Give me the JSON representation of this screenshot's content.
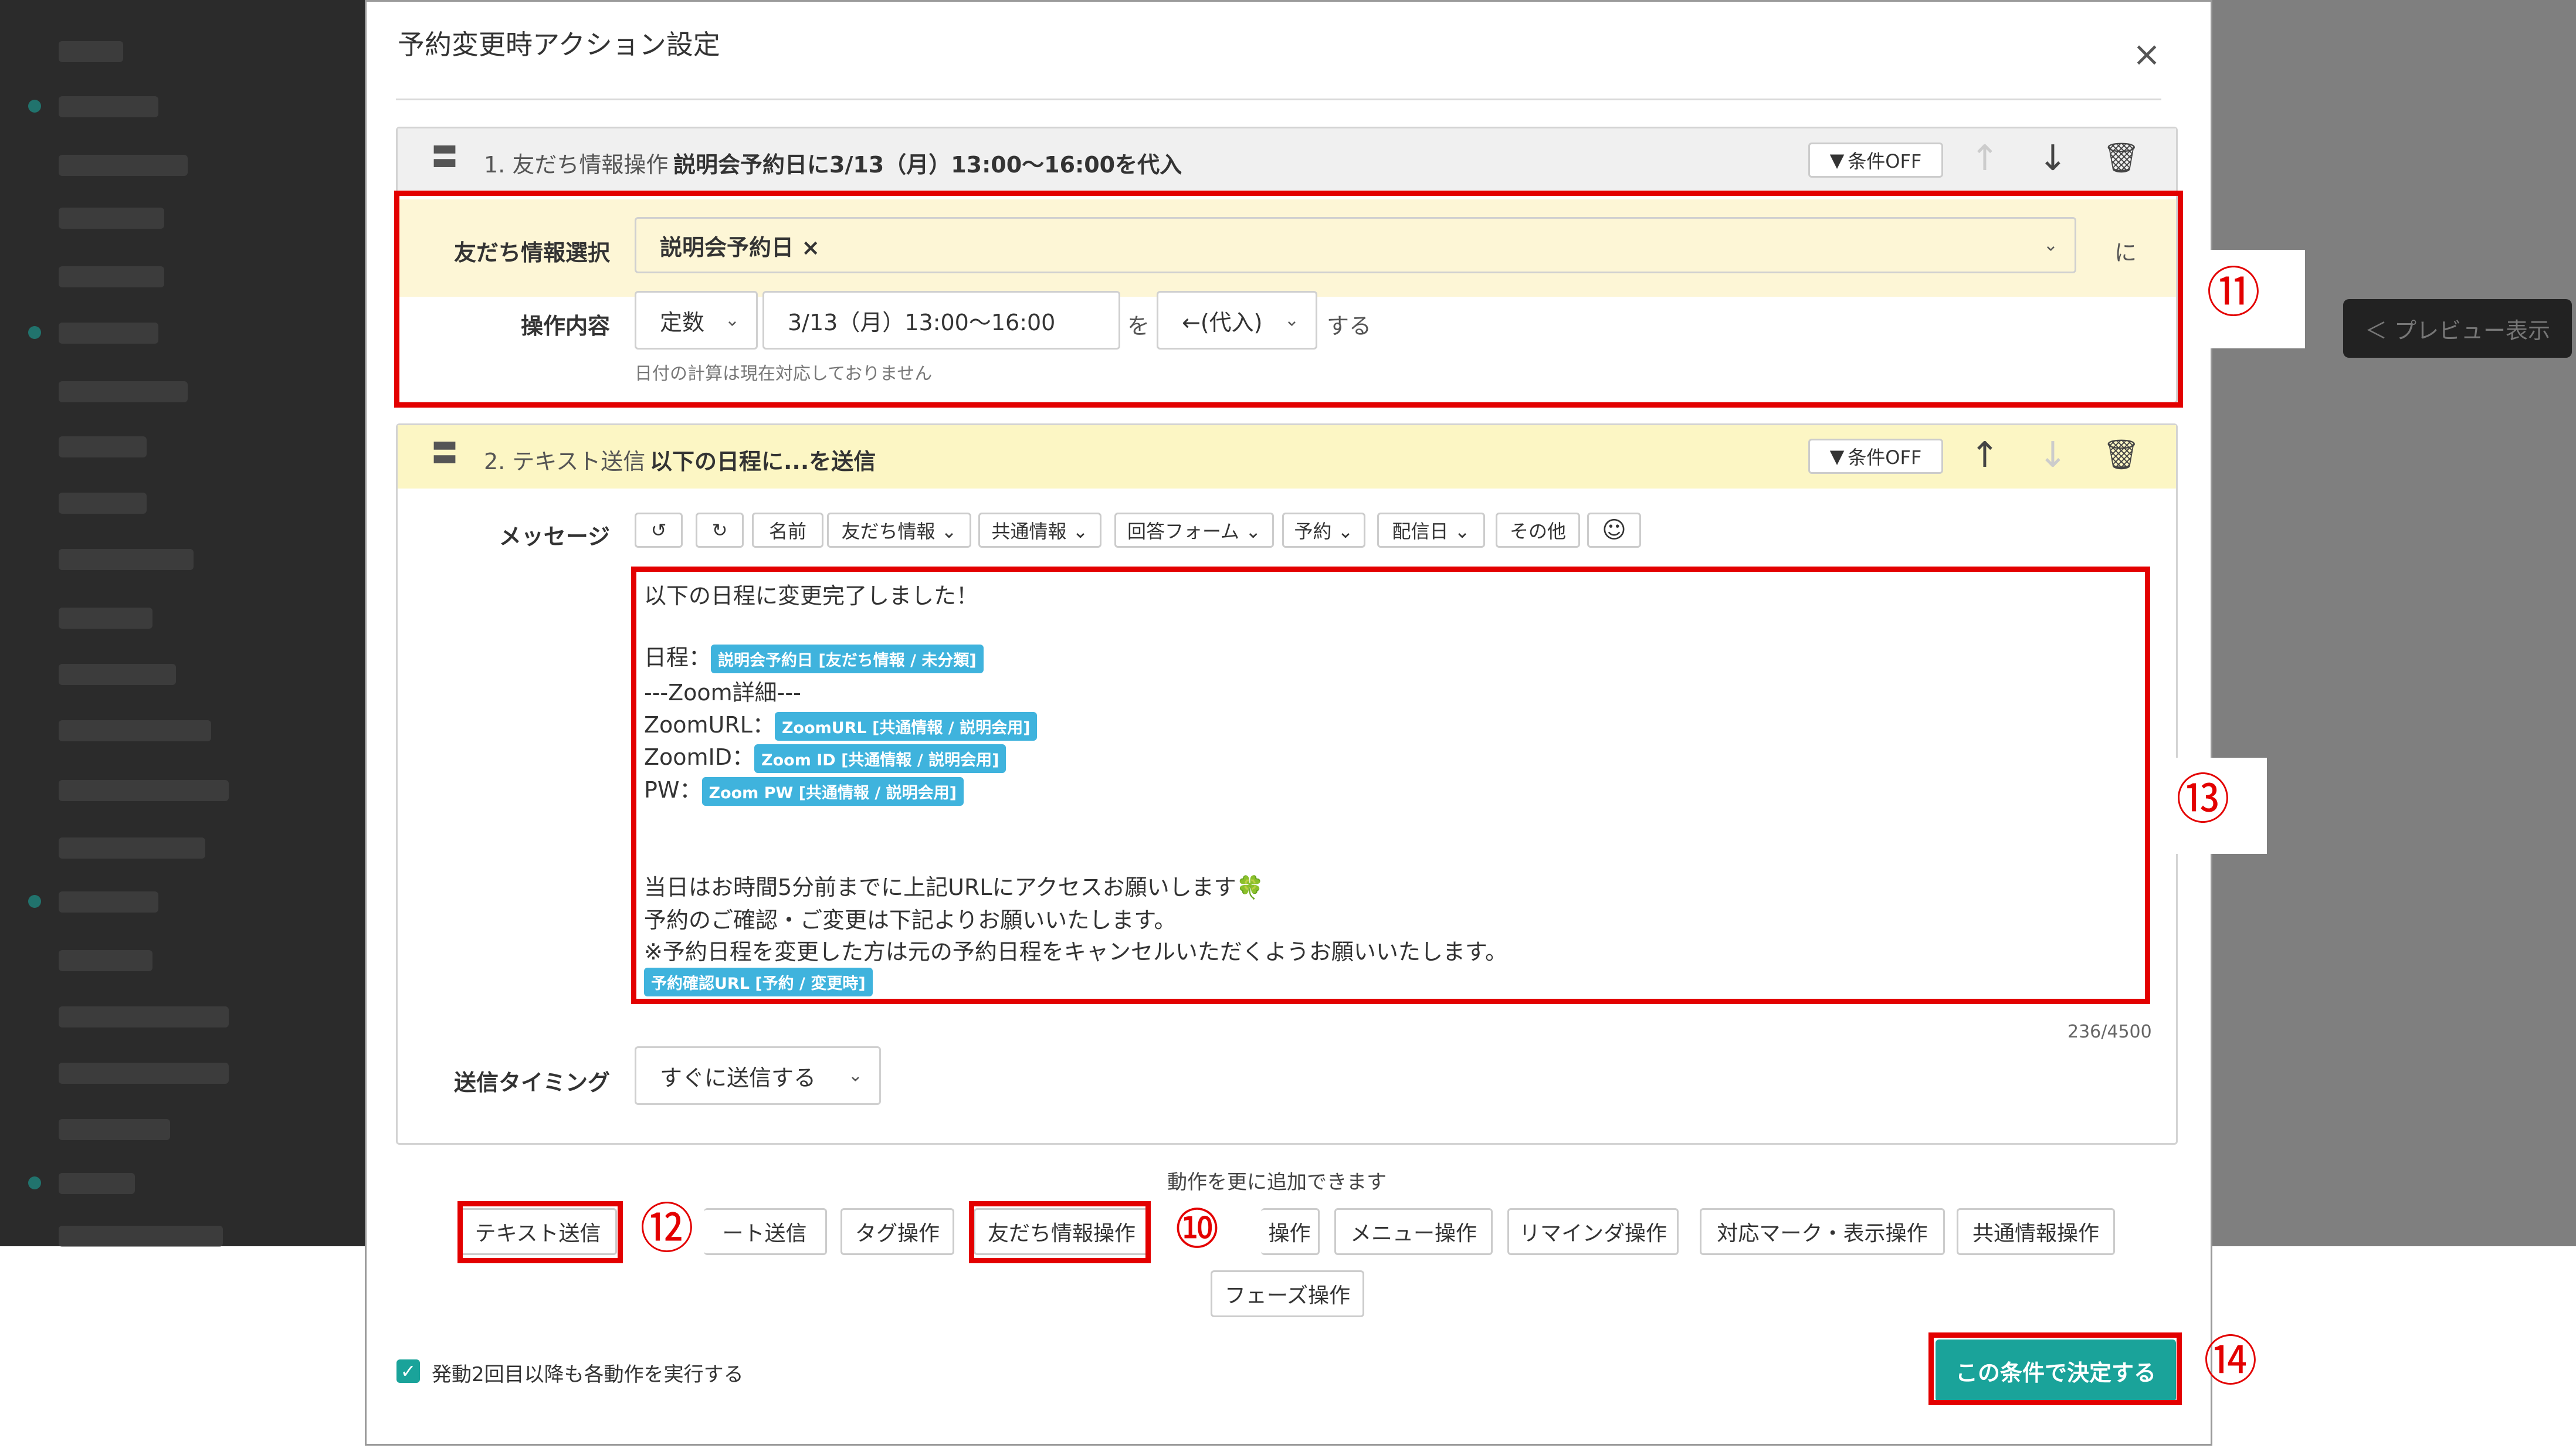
{
  "modal": {
    "title": "予約変更時アクション設定",
    "close": "×"
  },
  "action1": {
    "handle": "〓",
    "number_type": "1. 友だち情報操作",
    "summary": "説明会予約日に3/13（月）13:00～16:00を代入",
    "condition_label": "条件OFF",
    "friend_info_label": "友だち情報選択",
    "friend_info_value": "説明会予約日 ×",
    "ni": "に",
    "operation_label": "操作内容",
    "operation_type": "定数",
    "operation_value": "3/13（月）13:00～16:00",
    "wo": "を",
    "assign": "←(代入)",
    "suru": "する",
    "note": "日付の計算は現在対応しておりません"
  },
  "action2": {
    "handle": "〓",
    "number_type": "2. テキスト送信",
    "summary": "以下の日程に...を送信",
    "condition_label": "条件OFF",
    "message_label": "メッセージ",
    "toolbar": [
      "↺",
      "↻",
      "名前",
      "友だち情報 ⌄",
      "共通情報 ⌄",
      "回答フォーム ⌄",
      "予約 ⌄",
      "配信日 ⌄",
      "その他",
      "☺"
    ],
    "lines": {
      "l1": "以下の日程に変更完了しました！",
      "l2_text": "日程：",
      "l2_tag": "説明会予約日 [友だち情報 / 未分類]",
      "l3": "---Zoom詳細---",
      "l4_text": "ZoomURL：",
      "l4_tag": "ZoomURL [共通情報 / 説明会用]",
      "l5_text": "ZoomID：",
      "l5_tag": "Zoom ID [共通情報 / 説明会用]",
      "l6_text": "PW：",
      "l6_tag": "Zoom PW [共通情報 / 説明会用]",
      "l7": "当日はお時間5分前までに上記URLにアクセスお願いします🍀",
      "l8": "予約のご確認・ご変更は下記よりお願いいたします。",
      "l9": "※予約日程を変更した方は元の予約日程をキャンセルいただくようお願いいたします。",
      "l10_tag": "予約確認URL [予約 / 変更時]"
    },
    "counter": "236/4500",
    "timing_label": "送信タイミング",
    "timing_value": "すぐに送信する"
  },
  "add": {
    "hint": "動作を更に追加できます",
    "buttons": [
      "テキスト送信",
      "ート送信",
      "タグ操作",
      "友だち情報操作",
      "操作",
      "メニュー操作",
      "リマインダ操作",
      "対応マーク・表示操作",
      "共通情報操作",
      "フェーズ操作"
    ]
  },
  "footer": {
    "checkbox_label": "発動2回目以降も各動作を実行する",
    "submit": "この条件で決定する"
  },
  "annotations": {
    "n10": "⑩",
    "n11": "⑪",
    "n12": "⑫",
    "n13": "⑬",
    "n14": "⑭"
  },
  "background": {
    "preview_button": "＜ プレビュー表示"
  },
  "colors": {
    "accent": "#1aa39a",
    "highlight_row": "#fdf6d6",
    "action2_head": "#fcf6c4",
    "tag": "#3fb3dd",
    "annotation": "#e30000"
  }
}
